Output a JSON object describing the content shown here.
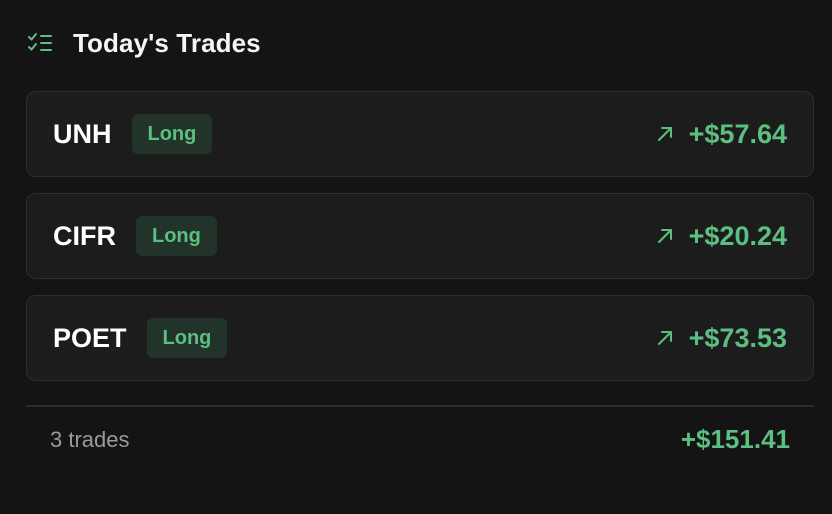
{
  "header": {
    "title": "Today's Trades",
    "icon": "checklist-icon"
  },
  "trades": [
    {
      "symbol": "UNH",
      "side": "Long",
      "pnl": "+$57.64",
      "trend_icon": "arrow-up-right-icon"
    },
    {
      "symbol": "CIFR",
      "side": "Long",
      "pnl": "+$20.24",
      "trend_icon": "arrow-up-right-icon"
    },
    {
      "symbol": "POET",
      "side": "Long",
      "pnl": "+$73.53",
      "trend_icon": "arrow-up-right-icon"
    }
  ],
  "footer": {
    "count_label": "3 trades",
    "total": "+$151.41"
  },
  "colors": {
    "background": "#141414",
    "card": "#1c1c1c",
    "positive": "#5cbf82",
    "badge_bg": "#223329"
  }
}
